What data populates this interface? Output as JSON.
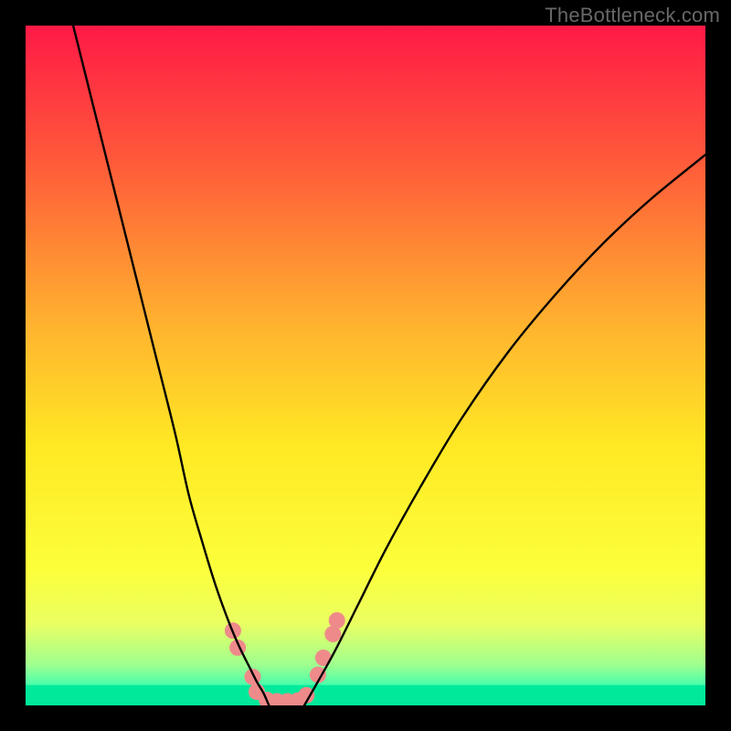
{
  "watermark": "TheBottleneck.com",
  "chart_data": {
    "type": "line",
    "title": "",
    "xlabel": "",
    "ylabel": "",
    "xlim": [
      0,
      100
    ],
    "ylim": [
      0,
      100
    ],
    "grid": false,
    "legend": false,
    "background_gradient_stops": [
      {
        "offset": 0.0,
        "color": "#ff1946"
      },
      {
        "offset": 0.2,
        "color": "#ff5a3a"
      },
      {
        "offset": 0.45,
        "color": "#ffb62e"
      },
      {
        "offset": 0.62,
        "color": "#ffe924"
      },
      {
        "offset": 0.8,
        "color": "#fcff3b"
      },
      {
        "offset": 0.88,
        "color": "#eaff62"
      },
      {
        "offset": 0.94,
        "color": "#9fff8f"
      },
      {
        "offset": 0.975,
        "color": "#3bffb0"
      },
      {
        "offset": 1.0,
        "color": "#00e99a"
      }
    ],
    "series": [
      {
        "name": "left-branch",
        "color": "#000000",
        "x": [
          7.0,
          10.0,
          13.0,
          16.0,
          19.0,
          22.0,
          24.0,
          26.0,
          28.0,
          30.0,
          31.5,
          33.0,
          34.0,
          35.0,
          35.8
        ],
        "y": [
          100.0,
          88.0,
          76.0,
          64.0,
          52.0,
          40.0,
          31.0,
          24.0,
          17.5,
          12.0,
          8.5,
          5.5,
          3.5,
          1.8,
          0.0
        ]
      },
      {
        "name": "right-branch",
        "color": "#000000",
        "x": [
          41.0,
          43.0,
          45.5,
          49.0,
          53.0,
          58.0,
          64.0,
          71.0,
          78.0,
          85.0,
          92.0,
          100.0
        ],
        "y": [
          0.0,
          3.5,
          8.0,
          15.0,
          23.0,
          32.0,
          42.0,
          52.0,
          60.5,
          68.0,
          74.5,
          81.0
        ]
      }
    ],
    "floor_band": {
      "y": 0,
      "height_pct": 3.0,
      "color": "#00e99a"
    },
    "markers": {
      "name": "bottom-cluster",
      "color": "#ef8a8a",
      "radius_px": 9,
      "points": [
        {
          "x": 30.5,
          "y": 11.0
        },
        {
          "x": 31.2,
          "y": 8.5
        },
        {
          "x": 33.4,
          "y": 4.2
        },
        {
          "x": 34.0,
          "y": 2.0
        },
        {
          "x": 35.5,
          "y": 0.8
        },
        {
          "x": 37.0,
          "y": 0.6
        },
        {
          "x": 38.5,
          "y": 0.6
        },
        {
          "x": 40.0,
          "y": 0.7
        },
        {
          "x": 41.3,
          "y": 1.5
        },
        {
          "x": 43.0,
          "y": 4.5
        },
        {
          "x": 43.8,
          "y": 7.0
        },
        {
          "x": 45.2,
          "y": 10.5
        },
        {
          "x": 45.8,
          "y": 12.5
        }
      ]
    }
  }
}
